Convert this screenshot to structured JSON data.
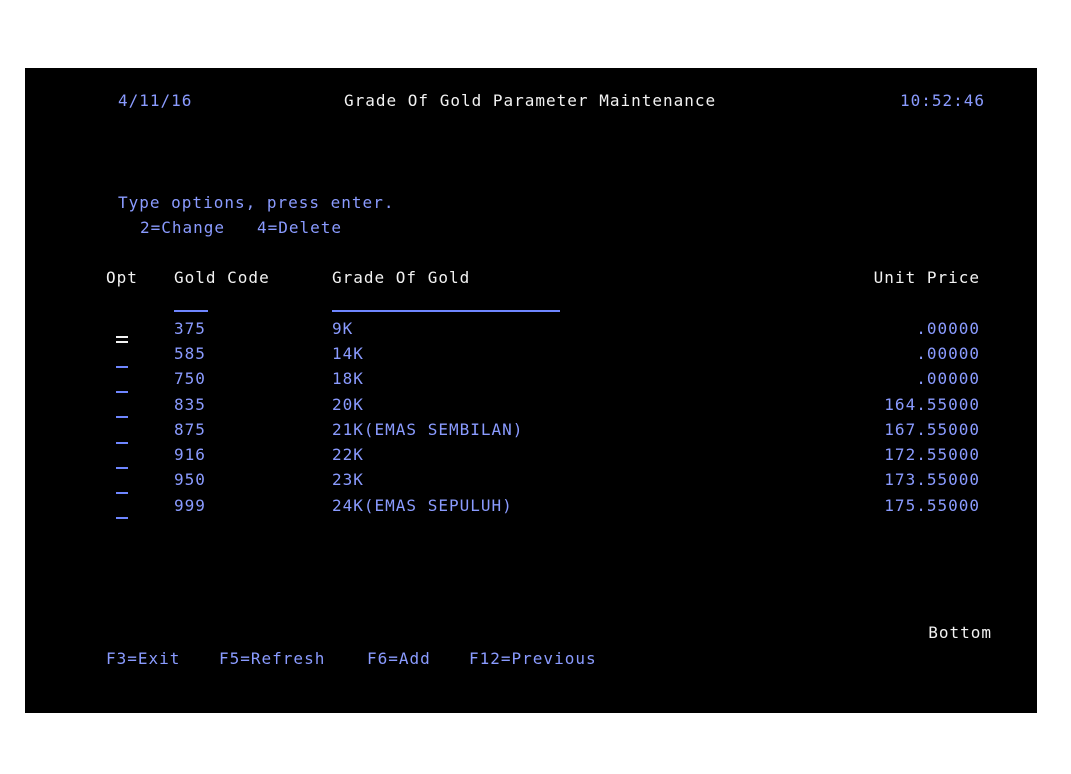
{
  "header": {
    "date": "4/11/16",
    "title": "Grade Of Gold Parameter Maintenance",
    "time": "10:52:46"
  },
  "instructions": {
    "line1": "Type options, press enter.",
    "line2": "2=Change   4=Delete"
  },
  "columns": {
    "opt": "Opt",
    "gold_code": "Gold Code",
    "grade": "Grade Of Gold",
    "unit_price": "Unit Price"
  },
  "rows": [
    {
      "code": "375",
      "grade": "9K",
      "price": ".00000"
    },
    {
      "code": "585",
      "grade": "14K",
      "price": ".00000"
    },
    {
      "code": "750",
      "grade": "18K",
      "price": ".00000"
    },
    {
      "code": "835",
      "grade": "20K",
      "price": "164.55000"
    },
    {
      "code": "875",
      "grade": "21K(EMAS SEMBILAN)",
      "price": "167.55000"
    },
    {
      "code": "916",
      "grade": "22K",
      "price": "172.55000"
    },
    {
      "code": "950",
      "grade": "23K",
      "price": "173.55000"
    },
    {
      "code": "999",
      "grade": "24K(EMAS SEPULUH)",
      "price": "175.55000"
    }
  ],
  "status": {
    "bottom": "Bottom"
  },
  "function_keys": {
    "exit": "F3=Exit",
    "refresh": "F5=Refresh",
    "add": "F6=Add",
    "previous": "F12=Previous"
  },
  "colors": {
    "background": "#000000",
    "field_text": "#8a9bff",
    "label_text": "#f2f2f2"
  }
}
